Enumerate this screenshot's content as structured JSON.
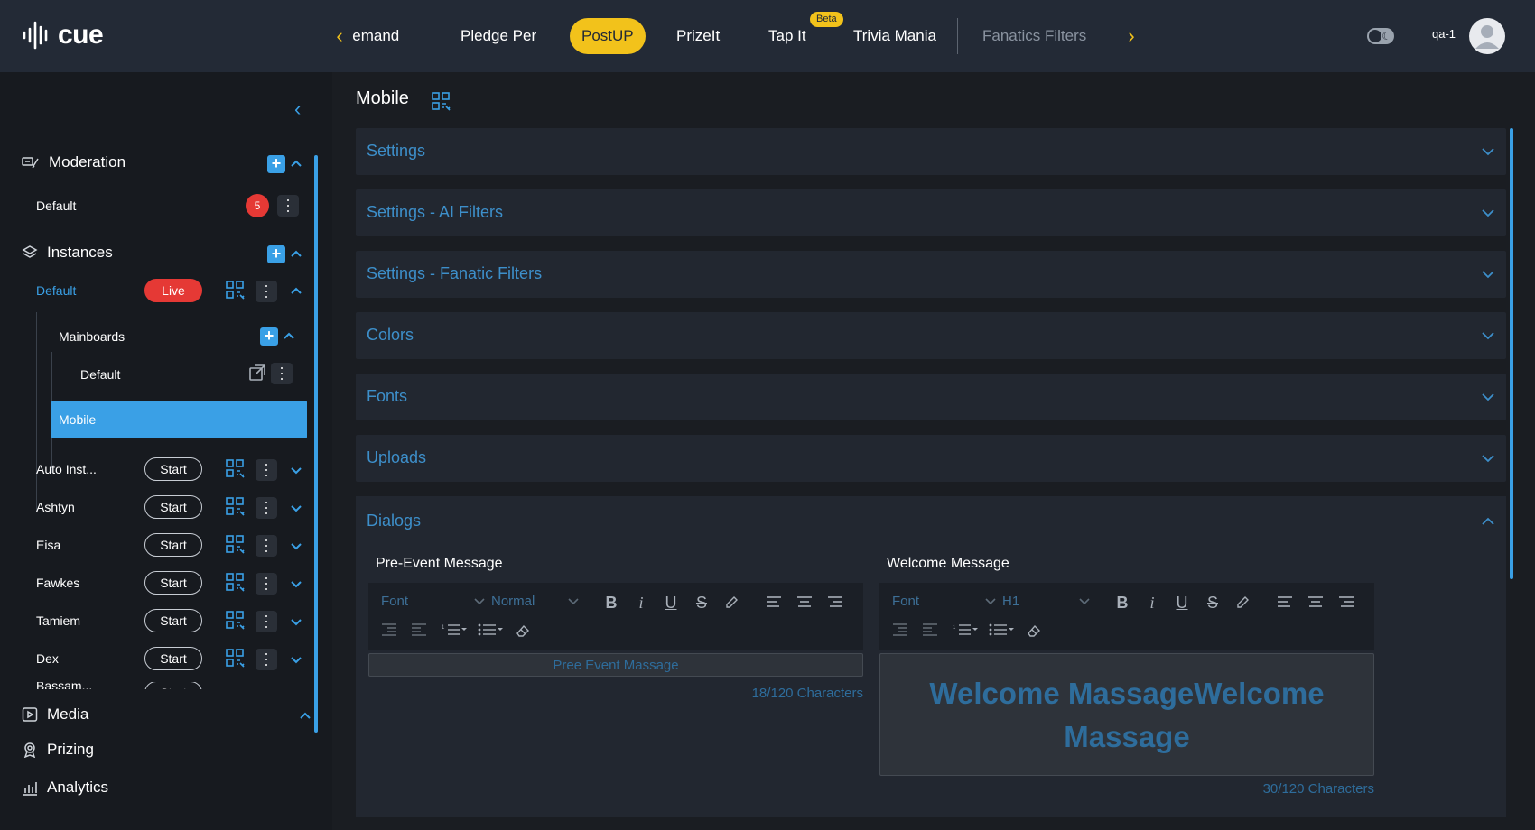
{
  "app": {
    "logo_text": "cue"
  },
  "topnav": {
    "tabs": [
      {
        "label": "Demand",
        "active": false
      },
      {
        "label": "Pledge Per",
        "active": false
      },
      {
        "label": "PostUP",
        "active": true
      },
      {
        "label": "PrizeIt",
        "active": false
      },
      {
        "label": "Tap It",
        "active": false,
        "badge": "Beta"
      },
      {
        "label": "Trivia Mania",
        "active": false
      },
      {
        "label": "Fanatics Filters",
        "active": false
      }
    ],
    "user_name": "qa-1"
  },
  "sidebar": {
    "moderation": {
      "label": "Moderation",
      "items": [
        {
          "label": "Default",
          "count": "5"
        }
      ]
    },
    "instances": {
      "label": "Instances",
      "default": {
        "label": "Default",
        "status": "Live"
      },
      "mainboards": {
        "label": "Mainboards",
        "items": [
          {
            "label": "Default"
          }
        ]
      },
      "selected": {
        "label": "Mobile"
      },
      "others": [
        {
          "label": "Auto Inst...",
          "action": "Start"
        },
        {
          "label": "Ashtyn",
          "action": "Start"
        },
        {
          "label": "Eisa",
          "action": "Start"
        },
        {
          "label": "Fawkes",
          "action": "Start"
        },
        {
          "label": "Tamiem",
          "action": "Start"
        },
        {
          "label": "Dex",
          "action": "Start"
        },
        {
          "label": "Bassam...",
          "action": "Start"
        }
      ]
    },
    "bottom_nav": [
      {
        "label": "Media",
        "icon": "media-icon"
      },
      {
        "label": "Prizing",
        "icon": "award-icon"
      },
      {
        "label": "Analytics",
        "icon": "bar-chart-icon"
      }
    ]
  },
  "main": {
    "title": "Mobile",
    "sections": [
      {
        "label": "Settings",
        "expanded": false
      },
      {
        "label": "Settings - AI Filters",
        "expanded": false
      },
      {
        "label": "Settings - Fanatic Filters",
        "expanded": false
      },
      {
        "label": "Colors",
        "expanded": false
      },
      {
        "label": "Fonts",
        "expanded": false
      },
      {
        "label": "Uploads",
        "expanded": false
      },
      {
        "label": "Dialogs",
        "expanded": true
      }
    ],
    "dialogs": {
      "pre_event": {
        "title": "Pre-Event Message",
        "font": "Font",
        "size": "Normal",
        "content": "Pree Event Massage",
        "count": "18/120 Characters"
      },
      "welcome": {
        "title": "Welcome Message",
        "font": "Font",
        "size": "H1",
        "content": "Welcome MassageWelcome Massage",
        "count": "30/120 Characters"
      }
    }
  },
  "colors": {
    "accent": "#3aa0e6",
    "brand_yellow": "#f2c21b",
    "live_red": "#e53935",
    "topbar": "#232a36"
  }
}
